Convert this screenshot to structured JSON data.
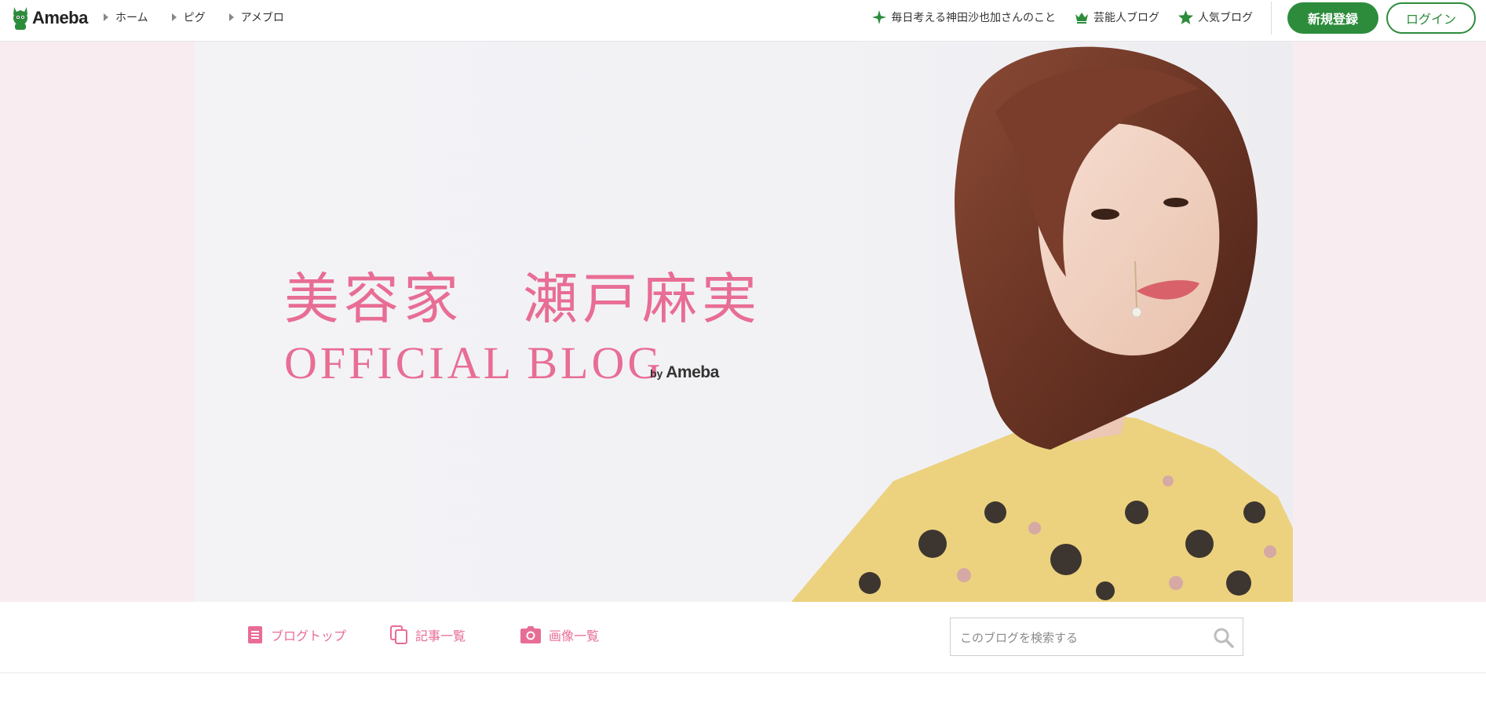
{
  "header": {
    "logo_text": "Ameba",
    "breadcrumbs": [
      {
        "label": "ホーム"
      },
      {
        "label": "ピグ"
      },
      {
        "label": "アメブロ"
      }
    ],
    "links": [
      {
        "label": "毎日考える神田沙也加さんのこと",
        "icon": "sparkle-icon"
      },
      {
        "label": "芸能人ブログ",
        "icon": "crown-icon"
      },
      {
        "label": "人気ブログ",
        "icon": "star-icon"
      }
    ],
    "register_label": "新規登録",
    "login_label": "ログイン"
  },
  "banner": {
    "title_jp": "美容家　瀬戸麻実",
    "title_en": "OFFICIAL BLOG",
    "by_label": "by",
    "by_brand": "Ameba"
  },
  "blognav": {
    "items": [
      {
        "label": "ブログトップ",
        "icon": "document-icon"
      },
      {
        "label": "記事一覧",
        "icon": "copy-icon"
      },
      {
        "label": "画像一覧",
        "icon": "camera-icon"
      }
    ],
    "search_placeholder": "このブログを検索する"
  },
  "colors": {
    "brand_green": "#2d8c3c",
    "accent_pink": "#e86d94",
    "hero_bg": "#f8ecf0"
  }
}
